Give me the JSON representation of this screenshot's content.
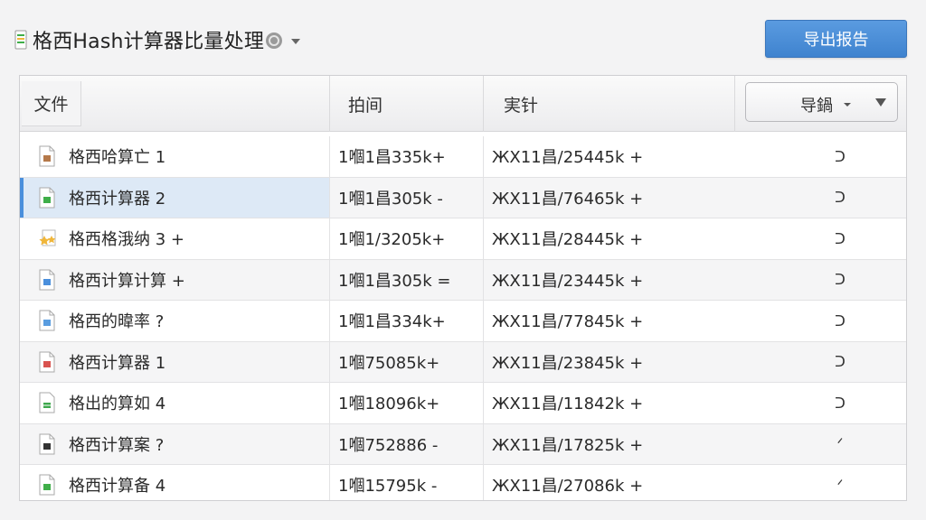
{
  "app": {
    "title": "格西Hash计算器比量处理",
    "export_button": "导出报告"
  },
  "table": {
    "headers": {
      "file": "文件",
      "time": "拍间",
      "value": "実针",
      "nav_select": "导鍋"
    },
    "rows": [
      {
        "name": "格西哈算亡 1",
        "time": "1嗰1昌335k+",
        "value": "ЖX11昌/25445k +",
        "check": "ᑐ",
        "icon": "document-brown-icon",
        "icon_color": "#b5794a",
        "selected": false
      },
      {
        "name": "格西计算器 2",
        "time": "1嗰1昌305k -",
        "value": "ЖX11昌/76465k +",
        "check": "ᑐ",
        "icon": "document-green-icon",
        "icon_color": "#3fae49",
        "selected": true
      },
      {
        "name": "格西格涐纳 3 +",
        "time": "1嗰1/3205k+",
        "value": "ЖX11昌/28445k +",
        "check": "ᑐ",
        "icon": "star-icon",
        "icon_color": "#f0b63a",
        "selected": false
      },
      {
        "name": "格西计算计算 +",
        "time": "1嗰1昌305k =",
        "value": "ЖX11昌/23445k +",
        "check": "ᑐ",
        "icon": "document-blue-icon",
        "icon_color": "#4a8fdc",
        "selected": false
      },
      {
        "name": "格西的暐率 ?",
        "time": "1嗰1昌334k+",
        "value": "ЖX11昌/77845k +",
        "check": "ᑐ",
        "icon": "document-blue-icon",
        "icon_color": "#5a9de0",
        "selected": false
      },
      {
        "name": "格西计算器 1",
        "time": "1嗰75085k+",
        "value": "ЖX11昌/23845k +",
        "check": "ᑐ",
        "icon": "document-red-icon",
        "icon_color": "#d9534f",
        "selected": false
      },
      {
        "name": "格出的算如 4",
        "time": "1嗰18096k+",
        "value": "ЖX11昌/11842k +",
        "check": "ᑐ",
        "icon": "spreadsheet-green-icon",
        "icon_color": "#3fa84e",
        "selected": false
      },
      {
        "name": "格西计算案 ?",
        "time": "1嗰752886 -",
        "value": "ЖX11昌/17825k +",
        "check": "ᐟ",
        "icon": "document-dark-icon",
        "icon_color": "#333333",
        "selected": false
      },
      {
        "name": "格西计算备 4",
        "time": "1嗰15795k -",
        "value": "ЖX11昌/27086k +",
        "check": "ᐟ",
        "icon": "document-green-icon",
        "icon_color": "#3fae49",
        "selected": false
      }
    ]
  },
  "colors": {
    "accent": "#4a8fdc",
    "selected_row": "#dde9f6"
  }
}
